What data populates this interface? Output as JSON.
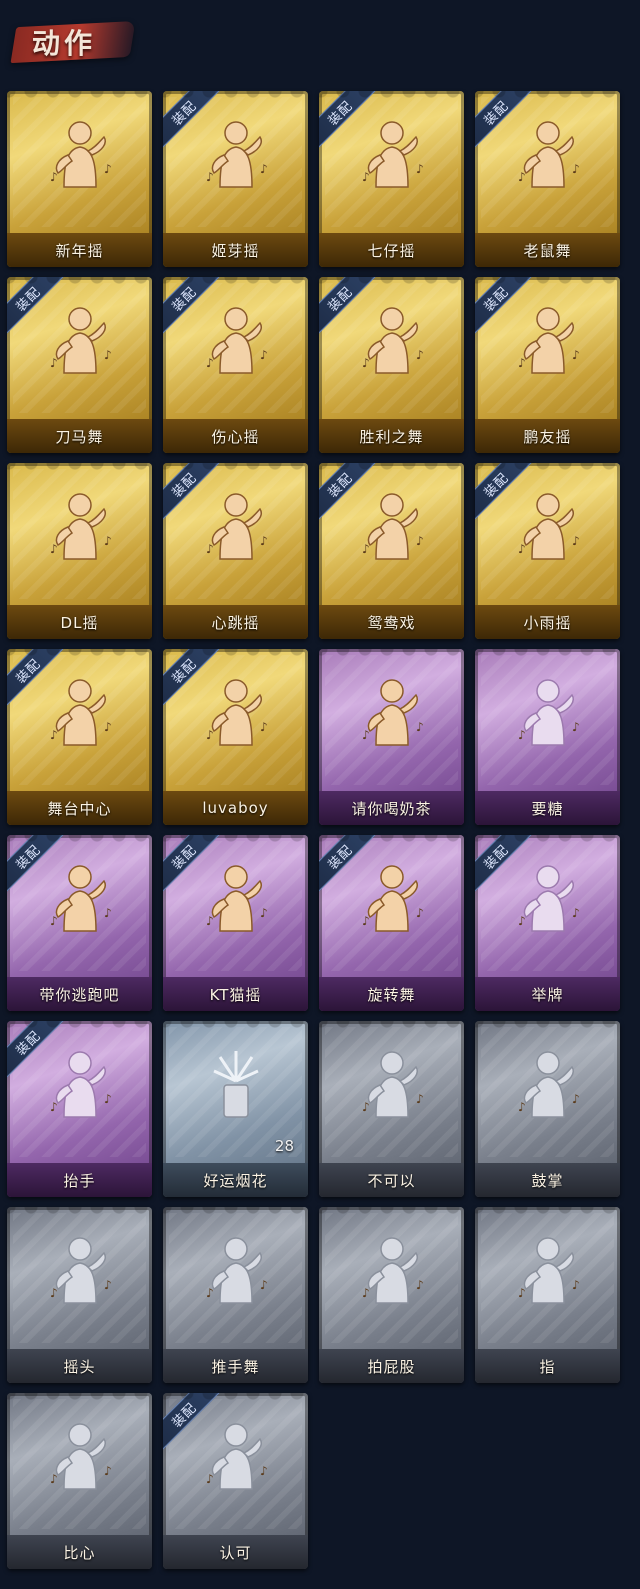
{
  "header": {
    "title": "动作"
  },
  "equip_tag": "装配",
  "cards": [
    {
      "label": "新年摇",
      "theme": "gold",
      "equipped": false,
      "icon": "dance-figure-icon"
    },
    {
      "label": "姬芽摇",
      "theme": "gold",
      "equipped": true,
      "icon": "dance-figure-icon"
    },
    {
      "label": "七仔摇",
      "theme": "gold",
      "equipped": true,
      "icon": "dance-figure-icon"
    },
    {
      "label": "老鼠舞",
      "theme": "gold",
      "equipped": true,
      "icon": "dance-figure-icon"
    },
    {
      "label": "刀马舞",
      "theme": "gold",
      "equipped": true,
      "icon": "dance-figure-icon"
    },
    {
      "label": "伤心摇",
      "theme": "gold",
      "equipped": true,
      "icon": "heart-hands-figure-icon"
    },
    {
      "label": "胜利之舞",
      "theme": "gold",
      "equipped": true,
      "icon": "victory-figure-icon"
    },
    {
      "label": "鹏友摇",
      "theme": "gold",
      "equipped": true,
      "icon": "dance-figure-icon"
    },
    {
      "label": "DL摇",
      "theme": "gold",
      "equipped": false,
      "icon": "arm-raise-figure-icon"
    },
    {
      "label": "心跳摇",
      "theme": "gold",
      "equipped": true,
      "icon": "dance-figure-icon"
    },
    {
      "label": "鸳鸯戏",
      "theme": "gold",
      "equipped": true,
      "icon": "dance-figure-icon"
    },
    {
      "label": "小雨摇",
      "theme": "gold",
      "equipped": true,
      "icon": "dance-figure-icon"
    },
    {
      "label": "舞台中心",
      "theme": "gold",
      "equipped": true,
      "icon": "dance-figure-icon"
    },
    {
      "label": "luvaboy",
      "theme": "gold",
      "equipped": true,
      "icon": "dance-figure-icon"
    },
    {
      "label": "请你喝奶茶",
      "theme": "purple",
      "equipped": false,
      "icon": "sign-holder-figure-icon",
      "gold_figure": true
    },
    {
      "label": "要糖",
      "theme": "purple",
      "equipped": false,
      "icon": "reach-figure-icon"
    },
    {
      "label": "带你逃跑吧",
      "theme": "purple",
      "equipped": true,
      "icon": "run-figure-icon",
      "gold_figure": true
    },
    {
      "label": "KT猫摇",
      "theme": "purple",
      "equipped": true,
      "icon": "dance-figure-icon",
      "gold_figure": true
    },
    {
      "label": "旋转舞",
      "theme": "purple",
      "equipped": true,
      "icon": "spin-figure-icon",
      "gold_figure": true
    },
    {
      "label": "举牌",
      "theme": "purple",
      "equipped": true,
      "icon": "sign-figure-icon"
    },
    {
      "label": "抬手",
      "theme": "purple",
      "equipped": true,
      "icon": "raise-hand-figure-icon"
    },
    {
      "label": "好运烟花",
      "theme": "blue",
      "equipped": false,
      "icon": "firework-icon",
      "count": "28"
    },
    {
      "label": "不可以",
      "theme": "gray",
      "equipped": false,
      "icon": "finger-wag-icon"
    },
    {
      "label": "鼓掌",
      "theme": "gray",
      "equipped": false,
      "icon": "clap-icon"
    },
    {
      "label": "摇头",
      "theme": "gray",
      "equipped": false,
      "icon": "dance-figure-icon"
    },
    {
      "label": "推手舞",
      "theme": "gray",
      "equipped": false,
      "icon": "dance-figure-icon"
    },
    {
      "label": "拍屁股",
      "theme": "gray",
      "equipped": false,
      "icon": "bend-figure-icon"
    },
    {
      "label": "指",
      "theme": "gray",
      "equipped": false,
      "icon": "point-hand-icon"
    },
    {
      "label": "比心",
      "theme": "gray",
      "equipped": false,
      "icon": "finger-heart-icon"
    },
    {
      "label": "认可",
      "theme": "gray",
      "equipped": true,
      "icon": "thumbs-up-icon"
    }
  ]
}
